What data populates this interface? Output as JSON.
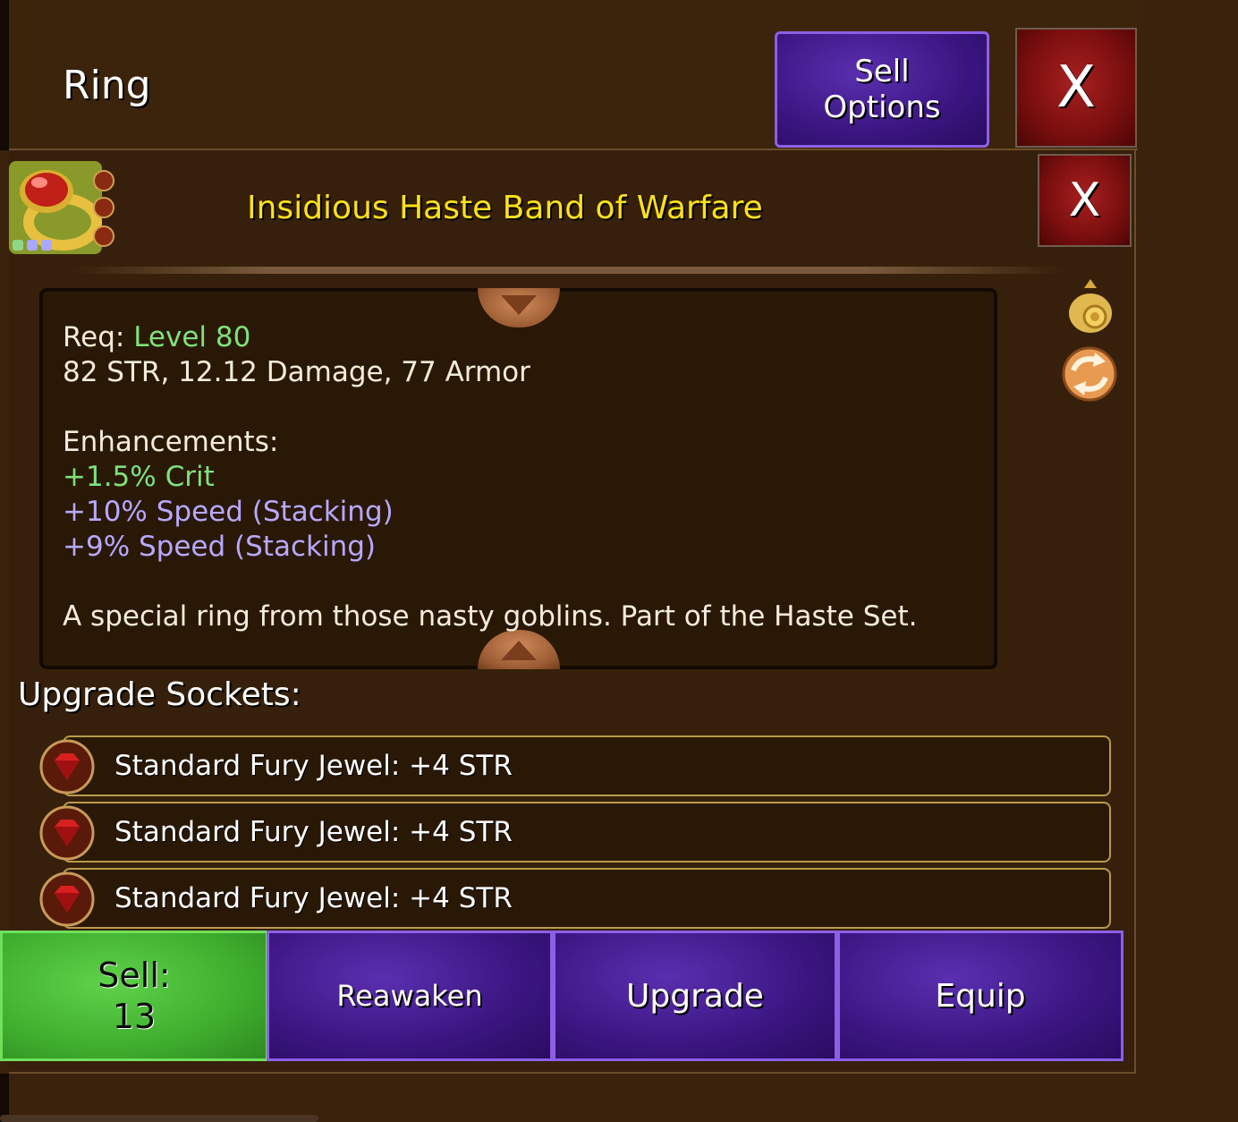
{
  "header": {
    "title": "Ring",
    "sell_options_label": "Sell\nOptions",
    "close_label": "X"
  },
  "item": {
    "name": "Insidious Haste Band of Warfare",
    "close_label": "X",
    "req_label": "Req:",
    "req_value": "Level 80",
    "stats": "82 STR, 12.12 Damage, 77 Armor",
    "enhancements_label": "Enhancements:",
    "enhancements": [
      "+1.5% Crit",
      "+10% Speed (Stacking)",
      "+9% Speed (Stacking)"
    ],
    "description": "A special ring from those nasty goblins. Part of the Haste Set."
  },
  "sockets": {
    "title": "Upgrade Sockets:",
    "items": [
      "Standard Fury Jewel: +4 STR",
      "Standard Fury Jewel: +4 STR",
      "Standard Fury Jewel: +4 STR"
    ]
  },
  "actions": {
    "sell_label": "Sell:\n13",
    "reawaken_label": "Reawaken",
    "upgrade_label": "Upgrade",
    "equip_label": "Equip"
  },
  "side_icons": [
    "gold-bag-icon",
    "reroll-icon"
  ],
  "colors": {
    "item_name": "#ffe11a",
    "level_req": "#7fe27a",
    "enh_crit": "#7fe27a",
    "enh_speed": "#b6a9ff",
    "purple_button": "#3a1580",
    "green_button": "#3fae2e",
    "close_red": "#7a0e0e"
  }
}
